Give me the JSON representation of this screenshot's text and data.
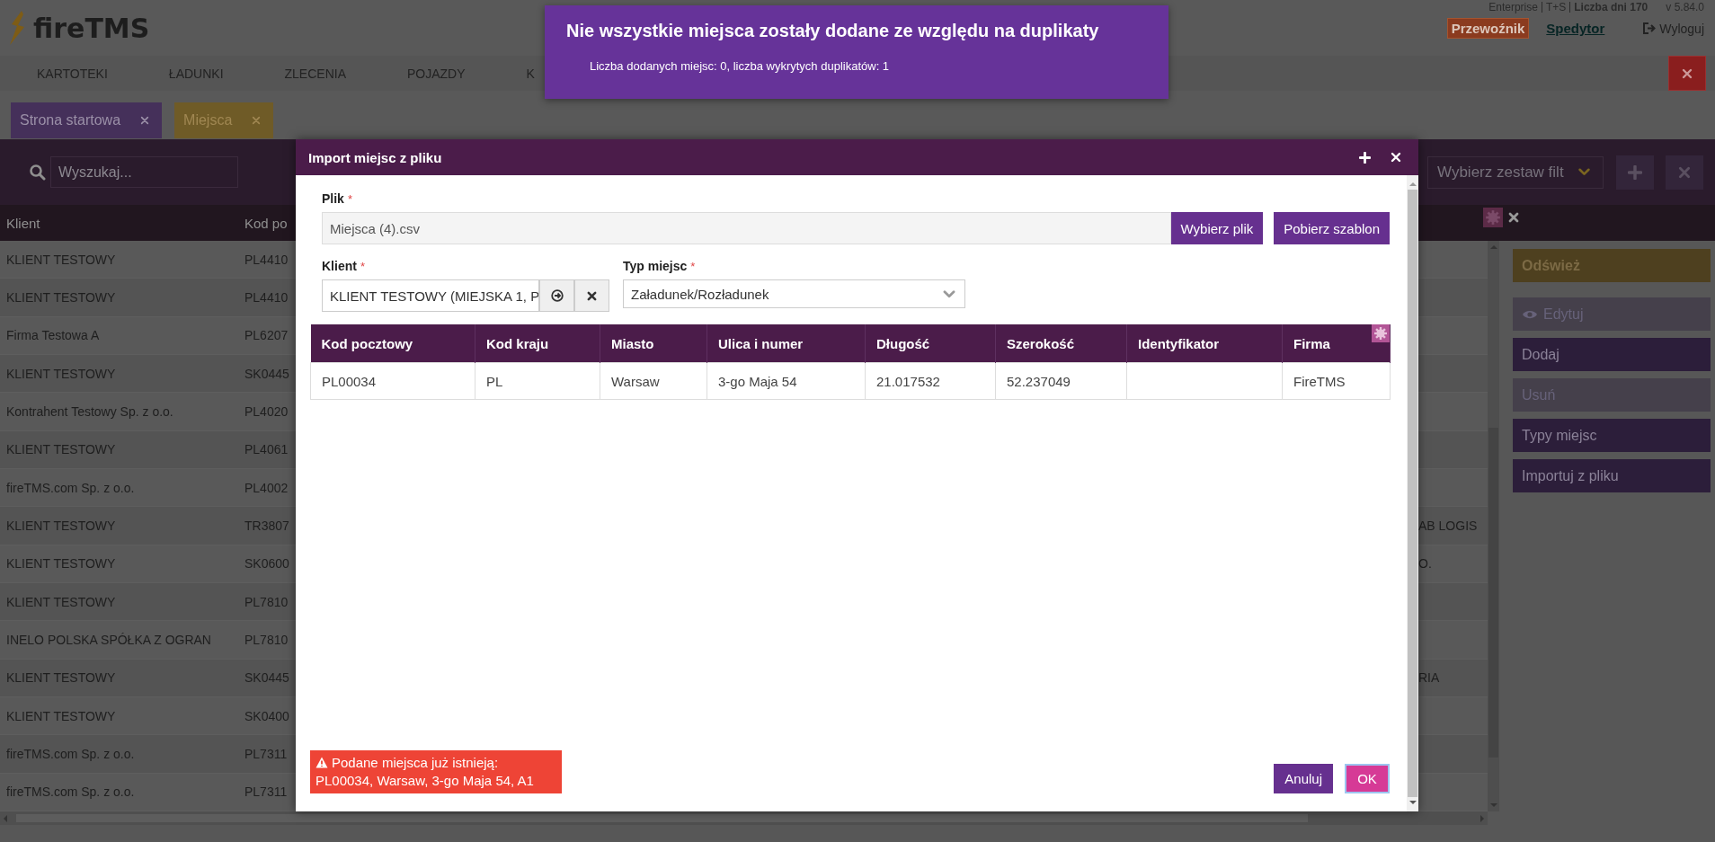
{
  "header": {
    "logo": "fireTMS",
    "edition": "Enterprise",
    "plan": "T+S",
    "days": "Liczba dni 170",
    "version": "v 5.84.0",
    "roles": [
      {
        "label": "Przewoźnik",
        "selected": true
      },
      {
        "label": "Spedytor",
        "selected": false
      }
    ],
    "logout": "Wyloguj"
  },
  "menu": [
    "KARTOTEKI",
    "ŁADUNKI",
    "ZLECENIA",
    "POJAZDY",
    "K"
  ],
  "tabs": [
    {
      "label": "Strona startowa",
      "selected": false
    },
    {
      "label": "Miejsca",
      "selected": true
    }
  ],
  "toolbar": {
    "search": {
      "placeholder": "Wyszukaj..."
    },
    "filter_set": {
      "value": "Wybierz zestaw filt"
    }
  },
  "table": {
    "columns": [
      "Klient",
      "Kod po"
    ],
    "rows": [
      {
        "cells": [
          "KLIENT TESTOWY",
          "PL4410"
        ]
      },
      {
        "cells": [
          "KLIENT TESTOWY",
          "PL4410"
        ]
      },
      {
        "cells": [
          "Firma Testowa A",
          "PL6207"
        ]
      },
      {
        "cells": [
          "KLIENT TESTOWY",
          "SK0445"
        ]
      },
      {
        "cells": [
          "Kontrahent Testowy Sp. z o.o.",
          "PL4020"
        ]
      },
      {
        "cells": [
          "KLIENT TESTOWY",
          "PL4061"
        ]
      },
      {
        "cells": [
          "fireTMS.com Sp. z o.o.",
          "PL4002"
        ]
      },
      {
        "cells": [
          "KLIENT TESTOWY",
          "TR3807"
        ],
        "column_3": "AB LOGIS"
      },
      {
        "cells": [
          "KLIENT TESTOWY",
          "SK0600"
        ],
        "column_3": "O."
      },
      {
        "cells": [
          "KLIENT TESTOWY",
          "PL7810"
        ]
      },
      {
        "cells": [
          "INELO POLSKA SPÓŁKA Z OGRAN",
          "PL7810"
        ]
      },
      {
        "cells": [
          "KLIENT TESTOWY",
          "SK0445"
        ],
        "column_3": "RIA"
      },
      {
        "cells": [
          "KLIENT TESTOWY",
          "SK0400"
        ]
      },
      {
        "cells": [
          "fireTMS.com Sp. z o.o.",
          "PL7311"
        ]
      },
      {
        "cells": [
          "fireTMS.com Sp. z o.o.",
          "PL7311"
        ]
      }
    ]
  },
  "actions": [
    {
      "label": "Odśwież",
      "kind": "refresh",
      "disabled": false
    },
    {
      "label": "Edytuj",
      "kind": "view",
      "disabled": true
    },
    {
      "label": "Dodaj",
      "kind": "plain",
      "disabled": false
    },
    {
      "label": "Usuń",
      "kind": "plain",
      "disabled": true
    },
    {
      "label": "Typy miejsc",
      "kind": "plain",
      "disabled": false
    },
    {
      "label": "Importuj z pliku",
      "kind": "plain",
      "disabled": false
    }
  ],
  "dialog": {
    "title": "Import miejsc z pliku",
    "file": {
      "label": "Plik",
      "required_mark": "*",
      "value": "Miejsca (4).csv"
    },
    "file_buttons": [
      "Wybierz plik",
      "Pobierz szablon"
    ],
    "client": {
      "label": "Klient",
      "required_mark": "*",
      "value": "KLIENT TESTOWY (MIEJSKA 1, P"
    },
    "place_type": {
      "label": "Typ miejsc",
      "required_mark": "*",
      "value": "Załadunek/Rozładunek"
    },
    "table": {
      "columns": [
        "Kod pocztowy",
        "Kod kraju",
        "Miasto",
        "Ulica i numer",
        "Długość",
        "Szerokość",
        "Identyfikator",
        "Firma"
      ],
      "rows": [
        [
          "PL00034",
          "PL",
          "Warsaw",
          "3-go Maja 54",
          "21.017532",
          "52.237049",
          null,
          "FireTMS"
        ]
      ]
    },
    "error": {
      "lines": [
        "Podane miejsca już istnieją:",
        "PL00034, Warsaw, 3-go Maja 54, A1"
      ]
    },
    "buttons": [
      {
        "label": "Anuluj",
        "kind": "cancel",
        "focused": false
      },
      {
        "label": "OK",
        "kind": "confirm",
        "focused": true
      }
    ]
  },
  "toast": {
    "title": "Nie wszystkie miejsca zostały dodane ze względu na duplikaty",
    "message": "Liczba dodanych miejsc: 0, liczba wykrytych duplikatów: 1"
  }
}
